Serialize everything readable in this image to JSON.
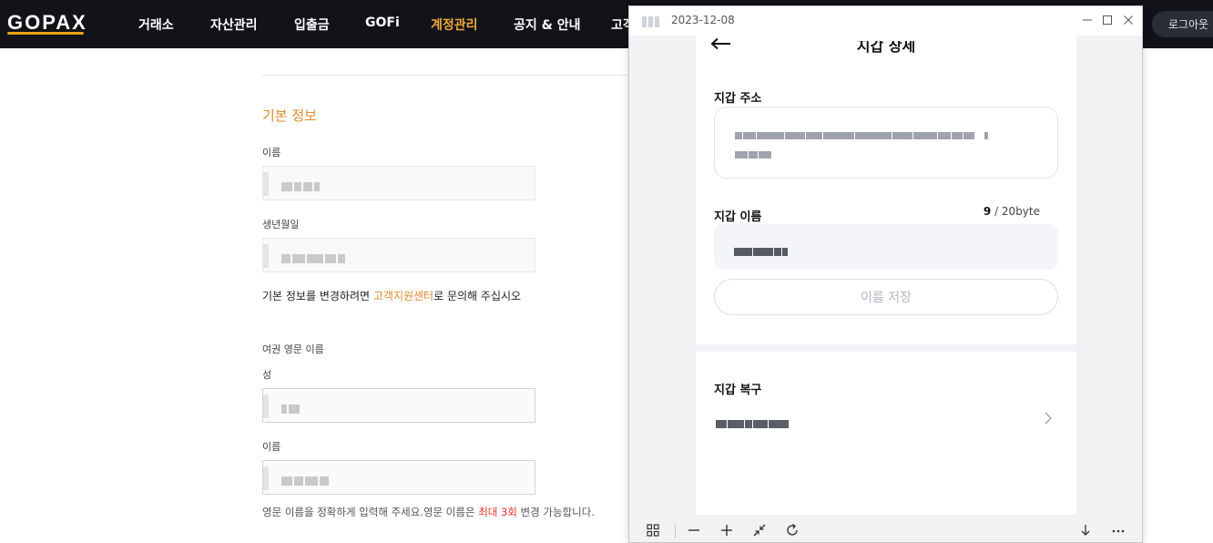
{
  "brand": {
    "logo": "GOPAX",
    "accent_color": "#e6a316"
  },
  "nav": {
    "items": [
      {
        "label": "거래소",
        "active": false
      },
      {
        "label": "자산관리",
        "active": false
      },
      {
        "label": "입출금",
        "active": false
      },
      {
        "label": "GOFi",
        "active": false
      },
      {
        "label": "계정관리",
        "active": true
      },
      {
        "label": "공지 & 안내",
        "active": false
      },
      {
        "label": "고객",
        "active": false
      }
    ],
    "logout_label": "로그아웃"
  },
  "basic_info": {
    "title": "기본 정보",
    "name_label": "이름",
    "birth_label": "생년월일",
    "change_notice_prefix": "기본 정보를 변경하려면 ",
    "support_link": "고객지원센터",
    "change_notice_suffix": "로 문의해 주십시오"
  },
  "passport": {
    "title": "여권 영문 이름",
    "last_name_label": "성",
    "first_name_label": "이름",
    "notice_prefix": "영문 이름을 정확하게 입력해 주세요.영문 이름은 ",
    "notice_highlight": "최대 3회",
    "notice_suffix": " 변경 가능합니다."
  },
  "popup": {
    "title_date": "2023-12-08",
    "header": "지갑 상세",
    "address_label": "지갑 주소",
    "name_label": "지갑 이름",
    "name_count": "9",
    "name_limit": "/ 20byte",
    "save_button": "이름 저장",
    "recovery_label": "지갑 복구"
  },
  "icons": {
    "back": "arrow-left-icon",
    "minimize": "minimize-icon",
    "maximize": "maximize-icon",
    "close": "close-icon",
    "chevron": "chevron-right-icon",
    "grid": "grid-icon",
    "zoom_out": "minus-icon",
    "zoom_in": "plus-icon",
    "fit": "collapse-icon",
    "rotate": "rotate-icon",
    "download": "download-icon",
    "more": "more-icon"
  }
}
